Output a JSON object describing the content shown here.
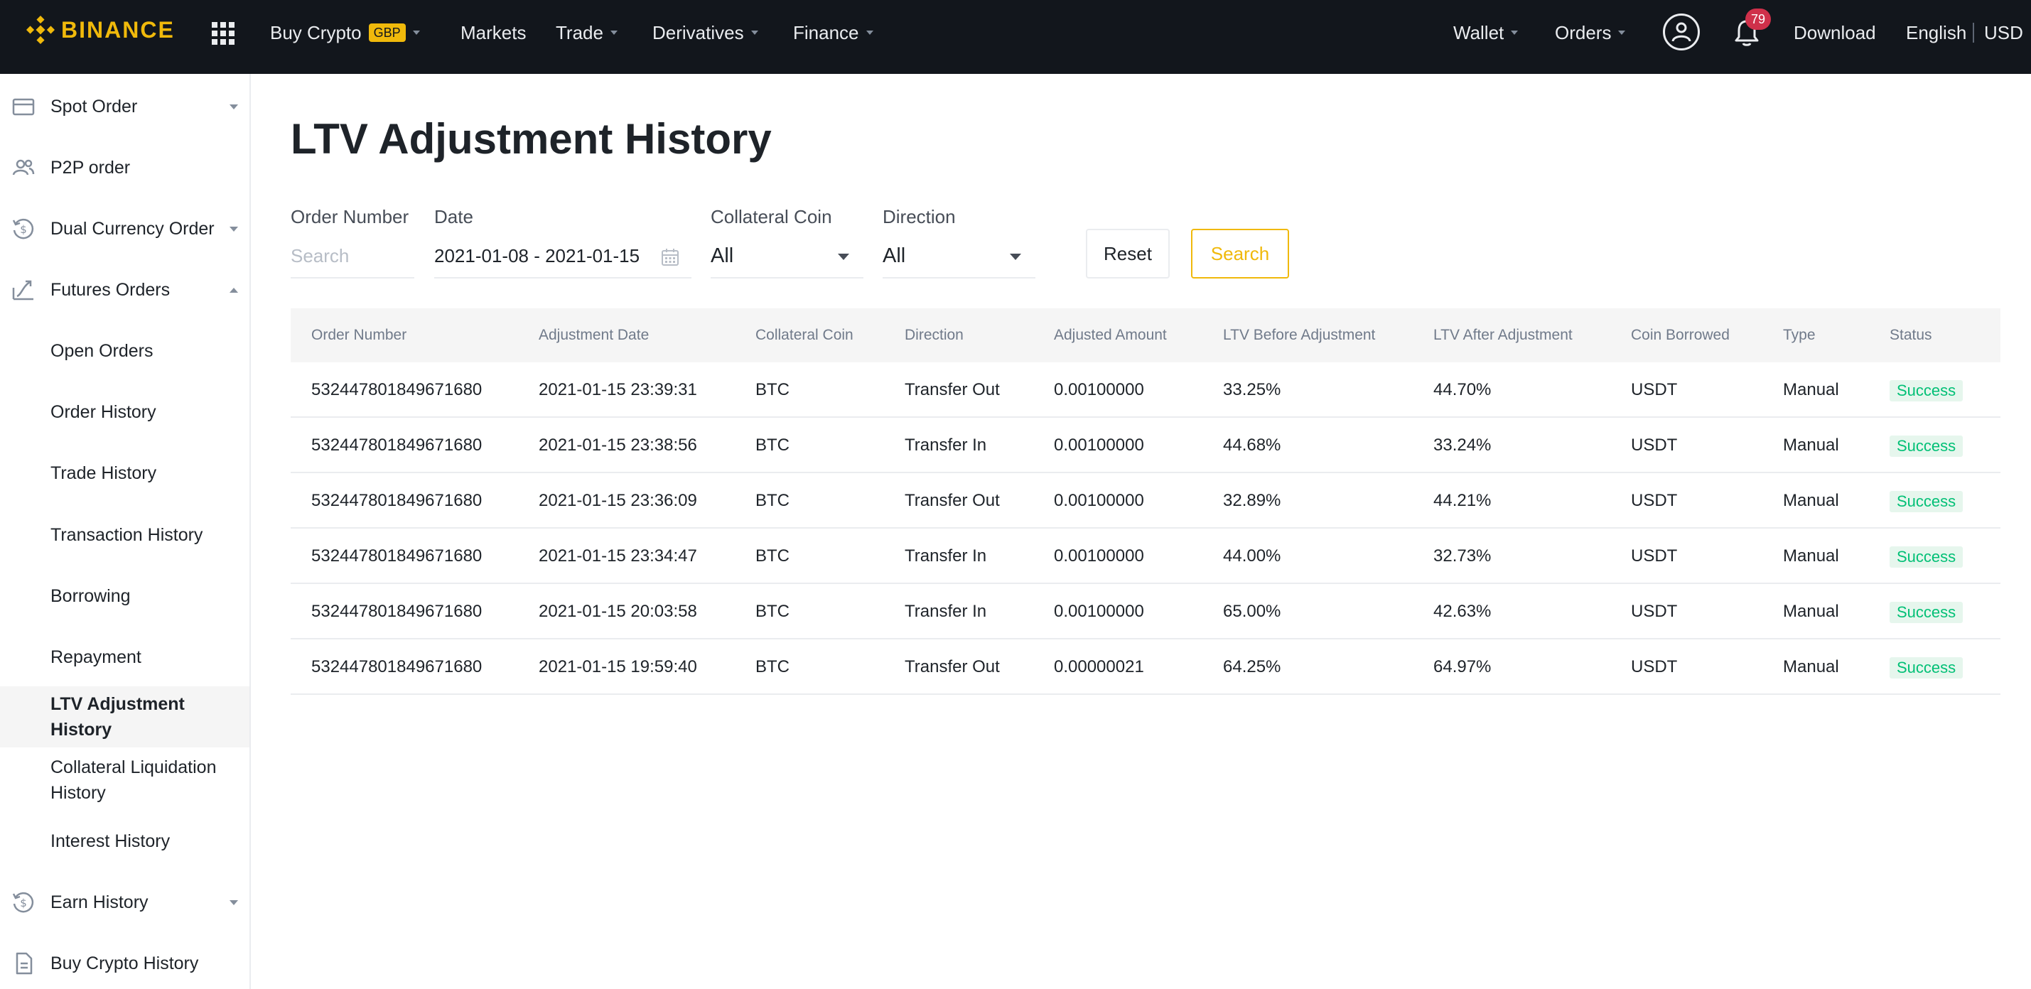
{
  "brand": {
    "name": "BINANCE",
    "color": "#f0b90b"
  },
  "topnav": {
    "buy_crypto": "Buy Crypto",
    "currency_badge": "GBP",
    "markets": "Markets",
    "trade": "Trade",
    "derivatives": "Derivatives",
    "finance": "Finance",
    "wallet": "Wallet",
    "orders": "Orders",
    "notification_count": "79",
    "download": "Download",
    "language": "English",
    "fiat": "USD"
  },
  "sidebar": {
    "items": [
      {
        "label": "Spot Order",
        "icon": "card-icon"
      },
      {
        "label": "P2P order",
        "icon": "people-icon"
      },
      {
        "label": "Dual Currency Order",
        "icon": "dollar-cycle-icon"
      },
      {
        "label": "Futures Orders",
        "icon": "futures-chart-icon"
      },
      {
        "label": "Open Orders"
      },
      {
        "label": "Order History"
      },
      {
        "label": "Trade History"
      },
      {
        "label": "Transaction History"
      },
      {
        "label": "Borrowing"
      },
      {
        "label": "Repayment"
      },
      {
        "label": "LTV Adjustment History"
      },
      {
        "label": "Collateral Liquidation History"
      },
      {
        "label": "Interest History"
      },
      {
        "label": "Earn History",
        "icon": "dollar-cycle-icon"
      },
      {
        "label": "Buy Crypto History",
        "icon": "document-icon"
      }
    ]
  },
  "page": {
    "title": "LTV Adjustment History"
  },
  "filters": {
    "order_number_label": "Order Number",
    "order_number_placeholder": "Search",
    "date_label": "Date",
    "date_value": "2021-01-08 - 2021-01-15",
    "collateral_label": "Collateral Coin",
    "collateral_value": "All",
    "direction_label": "Direction",
    "direction_value": "All",
    "reset": "Reset",
    "search": "Search"
  },
  "table": {
    "headers": [
      "Order Number",
      "Adjustment Date",
      "Collateral Coin",
      "Direction",
      "Adjusted Amount",
      "LTV Before Adjustment",
      "LTV After Adjustment",
      "Coin Borrowed",
      "Type",
      "Status"
    ],
    "rows": [
      [
        "532447801849671680",
        "2021-01-15 23:39:31",
        "BTC",
        "Transfer Out",
        "0.00100000",
        "33.25%",
        "44.70%",
        "USDT",
        "Manual",
        "Success"
      ],
      [
        "532447801849671680",
        "2021-01-15 23:38:56",
        "BTC",
        "Transfer In",
        "0.00100000",
        "44.68%",
        "33.24%",
        "USDT",
        "Manual",
        "Success"
      ],
      [
        "532447801849671680",
        "2021-01-15 23:36:09",
        "BTC",
        "Transfer Out",
        "0.00100000",
        "32.89%",
        "44.21%",
        "USDT",
        "Manual",
        "Success"
      ],
      [
        "532447801849671680",
        "2021-01-15 23:34:47",
        "BTC",
        "Transfer In",
        "0.00100000",
        "44.00%",
        "32.73%",
        "USDT",
        "Manual",
        "Success"
      ],
      [
        "532447801849671680",
        "2021-01-15 20:03:58",
        "BTC",
        "Transfer In",
        "0.00100000",
        "65.00%",
        "42.63%",
        "USDT",
        "Manual",
        "Success"
      ],
      [
        "532447801849671680",
        "2021-01-15 19:59:40",
        "BTC",
        "Transfer Out",
        "0.00000021",
        "64.25%",
        "64.97%",
        "USDT",
        "Manual",
        "Success"
      ]
    ]
  }
}
